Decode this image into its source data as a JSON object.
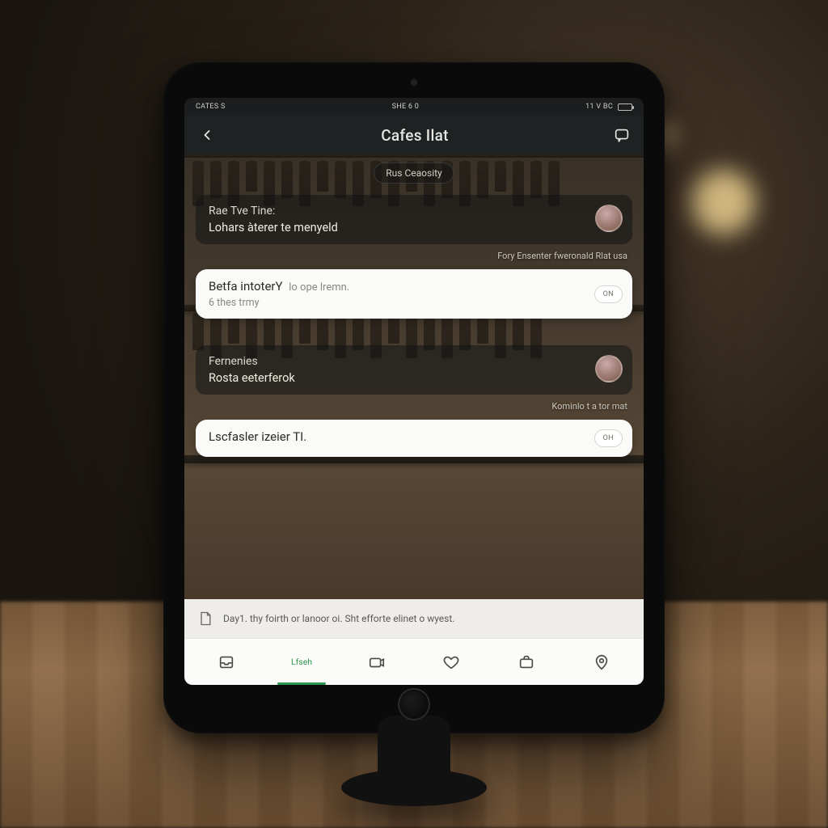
{
  "statusbar": {
    "left": "CATES S",
    "center": "SHE 6 0",
    "right": "11 V BC"
  },
  "header": {
    "title": "Cafes Ilat"
  },
  "pill": "Rus Ceaosity",
  "groups": [
    {
      "name": "Rae Tve Tine:",
      "message": "Lohars àterer te menyeld",
      "caption": "Fory Ensenter fweronald Rlat usa",
      "reply_title": "Betfa intoterY",
      "reply_sub_faded": "lo ope lremn.",
      "reply_line2": "6 thes trmy",
      "action": "ON"
    },
    {
      "name": "Fernenies",
      "message": "Rosta eeterferok",
      "caption": "Kominlo t a tor mat",
      "reply_title": "Lscfasler izeier TI.",
      "reply_sub_faded": "",
      "reply_line2": "",
      "action": "OH"
    }
  ],
  "banner": "Day1. thy foirth or lanoor oi. Sht efforte elinet o wyest.",
  "tabs": {
    "active_index": 1,
    "items": [
      {
        "label": ""
      },
      {
        "label": "Lfseh"
      },
      {
        "label": ""
      },
      {
        "label": ""
      },
      {
        "label": ""
      },
      {
        "label": ""
      }
    ]
  },
  "colors": {
    "accent": "#2e944f",
    "header_bg": "#1f2223",
    "card_white": "#fafaf8"
  }
}
